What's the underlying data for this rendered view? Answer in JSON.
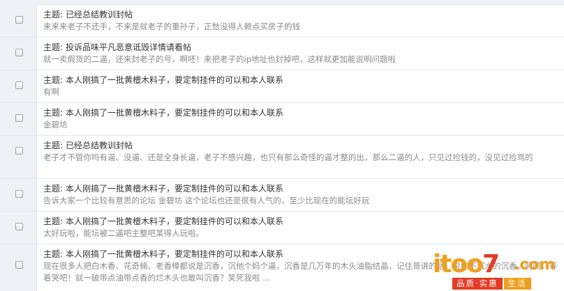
{
  "subject_prefix": "主题:",
  "posts": [
    {
      "title": "已经总结教训封帖",
      "body": "来来来老子不还手，不来是就老子的重孙子，正愁没得人赖点买房子的钱"
    },
    {
      "title": "投诉品味平凡恶意诋毁详情请看帖",
      "body": "就一卖假货的二逼，还来封老子的号，啊呸！来把老子的ip地址也封掉吧，这样就更加能说明问题啦"
    },
    {
      "title": "本人刚搞了一批黄檀木料子，要定制挂件的可以和本人联系",
      "body": "有啊"
    },
    {
      "title": "本人刚搞了一批黄檀木料子，要定制挂件的可以和本人联系",
      "body": "金碧坊"
    },
    {
      "title": "已经总结教训封帖",
      "body": "老子才不管你吗有逼、没逼、还是全身长逼，老子不感兴趣，也只有那么奇怪的逼才整的出，那么二逼的人，只见过捡钱的，没见过捡骂的"
    },
    {
      "title": "本人刚搞了一批黄檀木料子，要定制挂件的可以和本人联系",
      "body": "告诉大家一个比较有意思的论坛 金碧坊 这个论坛也还是很有人气的，至少比现在的能坛好玩"
    },
    {
      "title": "本人刚搞了一批黄檀木料子，要定制挂件的可以和本人联系",
      "body": "太好玩啦，能坛被二逼吧主整吧某得人玩啦。"
    },
    {
      "title": "本人刚搞了一批黄檀木料子，要定制挂件的可以和本人联系",
      "body": "现在很多人把白木香、花奇楠、老香樟都说是沉香，沉他个妈个逼，沉香是几万年的木头油脂结晶，记住哥讲的话，说的不沉水的沉香，呵呵，等着哭吧！就一破带点油带点香的烂木头也敢叫沉香？笑死我啦 ..."
    }
  ],
  "watermark": {
    "brand_main": "itoo",
    "brand_seven": "7",
    "brand_suffix": ".com",
    "tag_left": "品质·实惠",
    "tag_right": "生活"
  },
  "colors": {
    "title_text": "#333333",
    "body_text": "#8a8a8a",
    "row_divider": "#e2e8ee",
    "gutter_bg": "#eef2f6",
    "logo_orange": "#f0a020",
    "logo_red": "#e33b24"
  }
}
